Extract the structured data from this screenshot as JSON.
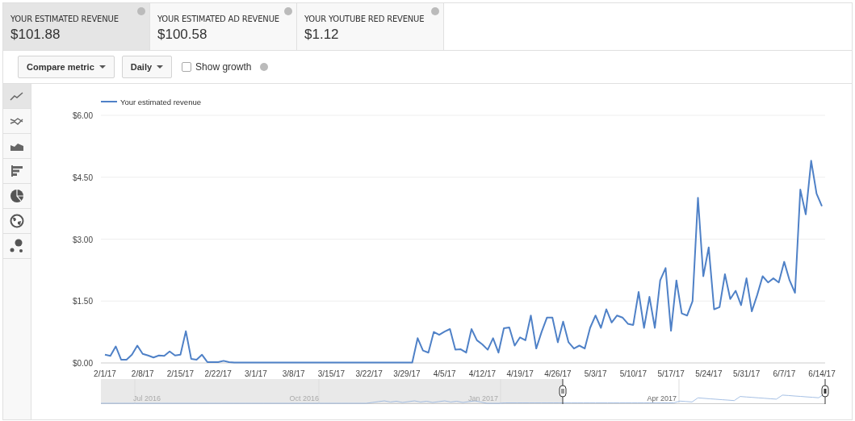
{
  "metric_tabs": [
    {
      "label": "YOUR ESTIMATED REVENUE",
      "value": "$101.88",
      "selected": true
    },
    {
      "label": "YOUR ESTIMATED AD REVENUE",
      "value": "$100.58",
      "selected": false
    },
    {
      "label": "YOUR YOUTUBE RED REVENUE",
      "value": "$1.12",
      "selected": false
    }
  ],
  "toolbar": {
    "compare_metric": "Compare metric",
    "period": "Daily",
    "show_growth": {
      "label": "Show growth",
      "checked": false
    }
  },
  "chart_types": [
    {
      "kind": "line",
      "selected": true
    },
    {
      "kind": "multiline",
      "selected": false
    },
    {
      "kind": "area",
      "selected": false
    },
    {
      "kind": "bar",
      "selected": false
    },
    {
      "kind": "pie",
      "selected": false
    },
    {
      "kind": "map",
      "selected": false
    },
    {
      "kind": "bubble",
      "selected": false
    }
  ],
  "chart": {
    "chart_data": {
      "type": "line",
      "ylim": [
        0,
        6
      ],
      "grid": true,
      "yticks": [
        {
          "value": 0,
          "label": "$0.00"
        },
        {
          "value": 1.5,
          "label": "$1.50"
        },
        {
          "value": 3,
          "label": "$3.00"
        },
        {
          "value": 4.5,
          "label": "$4.50"
        },
        {
          "value": 6,
          "label": "$6.00"
        }
      ],
      "categories": [
        "2/1/17",
        null,
        null,
        null,
        null,
        null,
        null,
        "2/8/17",
        null,
        null,
        null,
        null,
        null,
        null,
        "2/15/17",
        null,
        null,
        null,
        null,
        null,
        null,
        "2/22/17",
        null,
        null,
        null,
        null,
        null,
        null,
        "3/1/17",
        null,
        null,
        null,
        null,
        null,
        null,
        "3/8/17",
        null,
        null,
        null,
        null,
        null,
        null,
        "3/15/17",
        null,
        null,
        null,
        null,
        null,
        null,
        "3/22/17",
        null,
        null,
        null,
        null,
        null,
        null,
        "3/29/17",
        null,
        null,
        null,
        null,
        null,
        null,
        "4/5/17",
        null,
        null,
        null,
        null,
        null,
        null,
        "4/12/17",
        null,
        null,
        null,
        null,
        null,
        null,
        "4/19/17",
        null,
        null,
        null,
        null,
        null,
        null,
        "4/26/17",
        null,
        null,
        null,
        null,
        null,
        null,
        "5/3/17",
        null,
        null,
        null,
        null,
        null,
        null,
        "5/10/17",
        null,
        null,
        null,
        null,
        null,
        null,
        "5/17/17",
        null,
        null,
        null,
        null,
        null,
        null,
        "5/24/17",
        null,
        null,
        null,
        null,
        null,
        null,
        "5/31/17",
        null,
        null,
        null,
        null,
        null,
        null,
        "6/7/17",
        null,
        null,
        null,
        null,
        null,
        null,
        "6/14/17"
      ],
      "series": [
        {
          "name": "Your estimated revenue",
          "color": "#4f81c7",
          "values": [
            0.2,
            0.17,
            0.4,
            0.08,
            0.08,
            0.2,
            0.42,
            0.22,
            0.18,
            0.13,
            0.18,
            0.17,
            0.28,
            0.18,
            0.2,
            0.77,
            0.1,
            0.08,
            0.2,
            0.02,
            0.02,
            0.02,
            0.05,
            0.02,
            0.01,
            0.01,
            0.01,
            0.01,
            0.01,
            0.01,
            0.01,
            0.01,
            0.01,
            0.01,
            0.01,
            0.01,
            0.01,
            0.01,
            0.01,
            0.01,
            0.01,
            0.01,
            0.01,
            0.01,
            0.01,
            0.01,
            0.01,
            0.01,
            0.01,
            0.01,
            0.01,
            0.01,
            0.01,
            0.01,
            0.01,
            0.01,
            0.01,
            0.01,
            0.6,
            0.3,
            0.25,
            0.75,
            0.68,
            0.76,
            0.82,
            0.32,
            0.33,
            0.25,
            0.82,
            0.55,
            0.45,
            0.32,
            0.6,
            0.25,
            0.84,
            0.86,
            0.42,
            0.62,
            0.55,
            1.15,
            0.35,
            0.75,
            1.1,
            1.1,
            0.5,
            1.0,
            0.5,
            0.35,
            0.42,
            0.35,
            0.85,
            1.15,
            0.85,
            1.3,
            0.98,
            1.15,
            1.1,
            0.95,
            0.92,
            1.72,
            0.85,
            1.6,
            0.85,
            2.0,
            2.3,
            0.78,
            2.0,
            1.2,
            1.15,
            1.5,
            4.0,
            2.1,
            2.8,
            1.3,
            1.35,
            2.15,
            1.55,
            1.75,
            1.4,
            2.05,
            1.25,
            1.65,
            2.1,
            1.95,
            2.05,
            1.95,
            2.45,
            2.0,
            1.7,
            4.2,
            3.6,
            4.9,
            4.1,
            3.8
          ]
        }
      ]
    },
    "navigator_labels": [
      "Jul 2016",
      "Oct 2016",
      "Jan 2017",
      "Apr 2017"
    ]
  }
}
